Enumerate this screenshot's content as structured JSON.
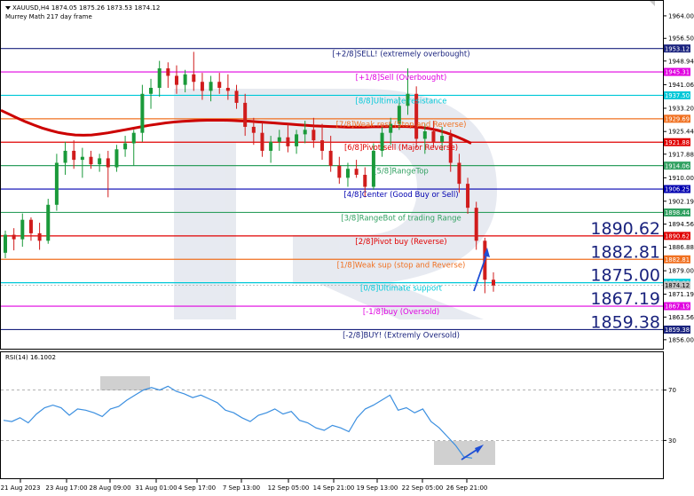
{
  "header": {
    "symbol_line": "XAUUSD,H4  1874.05 1875.26 1873.53 1874.12",
    "indicator_line": "Murrey Math 217 day frame"
  },
  "rsi_header": "RSI(14) 16.1002",
  "colors": {
    "up_candle": "#1a9a3a",
    "down_candle": "#d01c1c",
    "ma_line": "#cc0000",
    "rsi_line": "#3b8fe0",
    "arrow": "#1e4fd6",
    "highlight_box": "#c8c8c8"
  },
  "chart_data": [
    {
      "type": "candlestick",
      "title": "",
      "ylim": [
        1853,
        1969
      ],
      "y_ticks": [
        1964.0,
        1956.5,
        1948.94,
        1941.06,
        1933.2,
        1925.44,
        1917.88,
        1910.0,
        1902.19,
        1894.56,
        1886.88,
        1879.0,
        1871.19,
        1863.56,
        1856.0
      ],
      "x_ticks": [
        "21 Aug 2023",
        "23 Aug 17:00",
        "28 Aug 09:00",
        "31 Aug 01:00",
        "4 Sep 17:00",
        "7 Sep 13:00",
        "12 Sep 05:00",
        "14 Sep 21:00",
        "19 Sep 13:00",
        "22 Sep 05:00",
        "26 Sep 21:00"
      ],
      "murrey_levels": [
        {
          "label": "[+2/8]SELL! (extremely overbought)",
          "price": "1953.12",
          "value": 1953.12,
          "color": "#1a237e"
        },
        {
          "label": "[+1/8]Sell (Overbought)",
          "price": "1945.31",
          "value": 1945.31,
          "color": "#e000e0"
        },
        {
          "label": "[8/8]Ultimate resistance",
          "price": "1937.50",
          "value": 1937.5,
          "color": "#00c8d8"
        },
        {
          "label": "[7/8]Weak rest (Stop and Reverse)",
          "price": "1929.69",
          "value": 1929.69,
          "color": "#f07020"
        },
        {
          "label": "[6/8]Pivot sell (Major Reverse)",
          "price": "1921.88",
          "value": 1921.88,
          "color": "#e00000"
        },
        {
          "label": "[5/8]RangeTop",
          "price": "1914.06",
          "value": 1914.06,
          "color": "#30a060"
        },
        {
          "label": "[4/8]Center (Good Buy or Sell)",
          "price": "1906.25",
          "value": 1906.25,
          "color": "#0000b0"
        },
        {
          "label": "[3/8]RangeBot of trading Range",
          "price": "1898.44",
          "value": 1898.44,
          "color": "#30a060"
        },
        {
          "label": "[2/8]Pivot buy (Reverse)",
          "price": "1890.62",
          "value": 1890.62,
          "color": "#e00000"
        },
        {
          "label": "[1/8]Weak sup (stop and Reverse)",
          "price": "1882.81",
          "value": 1882.81,
          "color": "#f07020"
        },
        {
          "label": "[0/8]Ultimate support",
          "price": "1875.00",
          "value": 1875.0,
          "color": "#00c8d8"
        },
        {
          "label": "[-1/8]buy (Oversold)",
          "price": "1867.19",
          "value": 1867.19,
          "color": "#e000e0"
        },
        {
          "label": "[-2/8]BUY! (Extremly Oversold)",
          "price": "1859.38",
          "value": 1859.38,
          "color": "#1a237e"
        }
      ],
      "big_labels": [
        "1890.62",
        "1882.81",
        "1875.00",
        "1867.19",
        "1859.38"
      ],
      "current_price_label": "1874.12",
      "current_price": 1874.12,
      "ma": [
        1932.5,
        1931.2,
        1929.9,
        1928.7,
        1927.6,
        1926.6,
        1925.8,
        1925.1,
        1924.6,
        1924.3,
        1924.2,
        1924.3,
        1924.6,
        1925.0,
        1925.5,
        1926.0,
        1926.5,
        1927.0,
        1927.5,
        1927.9,
        1928.3,
        1928.6,
        1928.8,
        1929.0,
        1929.1,
        1929.2,
        1929.2,
        1929.2,
        1929.1,
        1929.0,
        1928.9,
        1928.7,
        1928.5,
        1928.3,
        1928.1,
        1927.9,
        1927.7,
        1927.5,
        1927.3,
        1927.2,
        1927.1,
        1927.0,
        1926.9,
        1926.9,
        1926.9,
        1927.0,
        1927.0,
        1927.1,
        1927.1,
        1927.1,
        1927.0,
        1926.8,
        1926.4,
        1925.8,
        1925.0,
        1924.0,
        1922.8,
        1921.5
      ],
      "candles": [
        {
          "o": 1885.0,
          "h": 1892.4,
          "l": 1883.2,
          "c": 1891.0
        },
        {
          "o": 1891.0,
          "h": 1893.2,
          "l": 1885.8,
          "c": 1889.5
        },
        {
          "o": 1889.5,
          "h": 1898.1,
          "l": 1887.0,
          "c": 1896.0
        },
        {
          "o": 1896.0,
          "h": 1896.8,
          "l": 1889.0,
          "c": 1891.5
        },
        {
          "o": 1891.5,
          "h": 1895.0,
          "l": 1886.0,
          "c": 1889.0
        },
        {
          "o": 1889.0,
          "h": 1903.0,
          "l": 1888.0,
          "c": 1901.0
        },
        {
          "o": 1901.0,
          "h": 1918.0,
          "l": 1899.0,
          "c": 1915.0
        },
        {
          "o": 1915.0,
          "h": 1922.0,
          "l": 1911.0,
          "c": 1919.0
        },
        {
          "o": 1919.0,
          "h": 1922.5,
          "l": 1913.0,
          "c": 1916.0
        },
        {
          "o": 1916.0,
          "h": 1920.0,
          "l": 1910.0,
          "c": 1917.0
        },
        {
          "o": 1917.0,
          "h": 1919.0,
          "l": 1913.0,
          "c": 1914.5
        },
        {
          "o": 1914.5,
          "h": 1918.0,
          "l": 1912.0,
          "c": 1916.5
        },
        {
          "o": 1916.5,
          "h": 1919.0,
          "l": 1903.5,
          "c": 1913.5
        },
        {
          "o": 1913.5,
          "h": 1921.0,
          "l": 1912.0,
          "c": 1919.5
        },
        {
          "o": 1919.5,
          "h": 1924.0,
          "l": 1917.0,
          "c": 1921.5
        },
        {
          "o": 1921.5,
          "h": 1926.0,
          "l": 1914.0,
          "c": 1925.0
        },
        {
          "o": 1925.0,
          "h": 1941.0,
          "l": 1922.0,
          "c": 1938.0
        },
        {
          "o": 1938.0,
          "h": 1943.0,
          "l": 1933.0,
          "c": 1940.0
        },
        {
          "o": 1940.0,
          "h": 1949.0,
          "l": 1937.0,
          "c": 1946.5
        },
        {
          "o": 1946.5,
          "h": 1948.5,
          "l": 1940.0,
          "c": 1944.0
        },
        {
          "o": 1944.0,
          "h": 1947.5,
          "l": 1938.0,
          "c": 1941.0
        },
        {
          "o": 1941.0,
          "h": 1946.0,
          "l": 1938.5,
          "c": 1944.5
        },
        {
          "o": 1944.5,
          "h": 1952.0,
          "l": 1939.0,
          "c": 1942.0
        },
        {
          "o": 1942.0,
          "h": 1945.0,
          "l": 1936.0,
          "c": 1939.0
        },
        {
          "o": 1939.0,
          "h": 1944.0,
          "l": 1935.5,
          "c": 1942.0
        },
        {
          "o": 1942.0,
          "h": 1945.0,
          "l": 1938.0,
          "c": 1940.0
        },
        {
          "o": 1940.0,
          "h": 1944.5,
          "l": 1936.0,
          "c": 1939.0
        },
        {
          "o": 1939.0,
          "h": 1941.0,
          "l": 1933.0,
          "c": 1935.0
        },
        {
          "o": 1935.0,
          "h": 1938.0,
          "l": 1924.0,
          "c": 1927.0
        },
        {
          "o": 1927.0,
          "h": 1930.0,
          "l": 1921.0,
          "c": 1925.0
        },
        {
          "o": 1925.0,
          "h": 1928.5,
          "l": 1917.0,
          "c": 1919.0
        },
        {
          "o": 1919.0,
          "h": 1924.0,
          "l": 1915.0,
          "c": 1922.0
        },
        {
          "o": 1922.0,
          "h": 1926.0,
          "l": 1919.0,
          "c": 1923.5
        },
        {
          "o": 1923.5,
          "h": 1928.0,
          "l": 1918.5,
          "c": 1920.5
        },
        {
          "o": 1920.5,
          "h": 1926.0,
          "l": 1918.0,
          "c": 1924.5
        },
        {
          "o": 1924.5,
          "h": 1929.0,
          "l": 1921.5,
          "c": 1926.0
        },
        {
          "o": 1926.0,
          "h": 1930.0,
          "l": 1920.0,
          "c": 1922.5
        },
        {
          "o": 1922.5,
          "h": 1928.0,
          "l": 1916.0,
          "c": 1919.0
        },
        {
          "o": 1919.0,
          "h": 1924.0,
          "l": 1912.0,
          "c": 1914.0
        },
        {
          "o": 1914.0,
          "h": 1917.0,
          "l": 1908.0,
          "c": 1910.0
        },
        {
          "o": 1910.0,
          "h": 1915.0,
          "l": 1907.0,
          "c": 1913.0
        },
        {
          "o": 1913.0,
          "h": 1916.0,
          "l": 1910.0,
          "c": 1911.0
        },
        {
          "o": 1911.0,
          "h": 1913.5,
          "l": 1903.5,
          "c": 1907.0
        },
        {
          "o": 1907.0,
          "h": 1921.5,
          "l": 1906.0,
          "c": 1919.0
        },
        {
          "o": 1919.0,
          "h": 1927.0,
          "l": 1917.0,
          "c": 1925.0
        },
        {
          "o": 1925.0,
          "h": 1930.0,
          "l": 1921.0,
          "c": 1928.0
        },
        {
          "o": 1928.0,
          "h": 1937.0,
          "l": 1926.0,
          "c": 1934.0
        },
        {
          "o": 1934.0,
          "h": 1946.5,
          "l": 1931.0,
          "c": 1938.0
        },
        {
          "o": 1938.0,
          "h": 1940.5,
          "l": 1920.0,
          "c": 1923.0
        },
        {
          "o": 1923.0,
          "h": 1928.0,
          "l": 1918.0,
          "c": 1925.5
        },
        {
          "o": 1925.5,
          "h": 1929.0,
          "l": 1920.0,
          "c": 1922.0
        },
        {
          "o": 1922.0,
          "h": 1927.0,
          "l": 1919.0,
          "c": 1924.0
        },
        {
          "o": 1924.0,
          "h": 1926.0,
          "l": 1912.0,
          "c": 1915.0
        },
        {
          "o": 1915.0,
          "h": 1918.0,
          "l": 1905.0,
          "c": 1908.0
        },
        {
          "o": 1908.0,
          "h": 1910.0,
          "l": 1898.0,
          "c": 1900.0
        },
        {
          "o": 1900.0,
          "h": 1902.0,
          "l": 1886.0,
          "c": 1889.0
        },
        {
          "o": 1889.0,
          "h": 1890.0,
          "l": 1871.5,
          "c": 1876.0
        },
        {
          "o": 1876.0,
          "h": 1878.5,
          "l": 1872.0,
          "c": 1874.1
        }
      ]
    },
    {
      "type": "line",
      "title": "RSI(14) 16.1002",
      "ylim": [
        0,
        100
      ],
      "y_ticks": [
        70,
        30
      ],
      "values": [
        46,
        45,
        48,
        44,
        51,
        56,
        58,
        56,
        50,
        55,
        54,
        52,
        49,
        55,
        57,
        62,
        66,
        70,
        72,
        70,
        73,
        69,
        67,
        64,
        66,
        63,
        60,
        54,
        52,
        48,
        45,
        50,
        52,
        55,
        51,
        53,
        46,
        44,
        40,
        38,
        42,
        40,
        37,
        48,
        55,
        58,
        62,
        66,
        54,
        56,
        52,
        55,
        45,
        40,
        33,
        26,
        17,
        16
      ]
    }
  ]
}
